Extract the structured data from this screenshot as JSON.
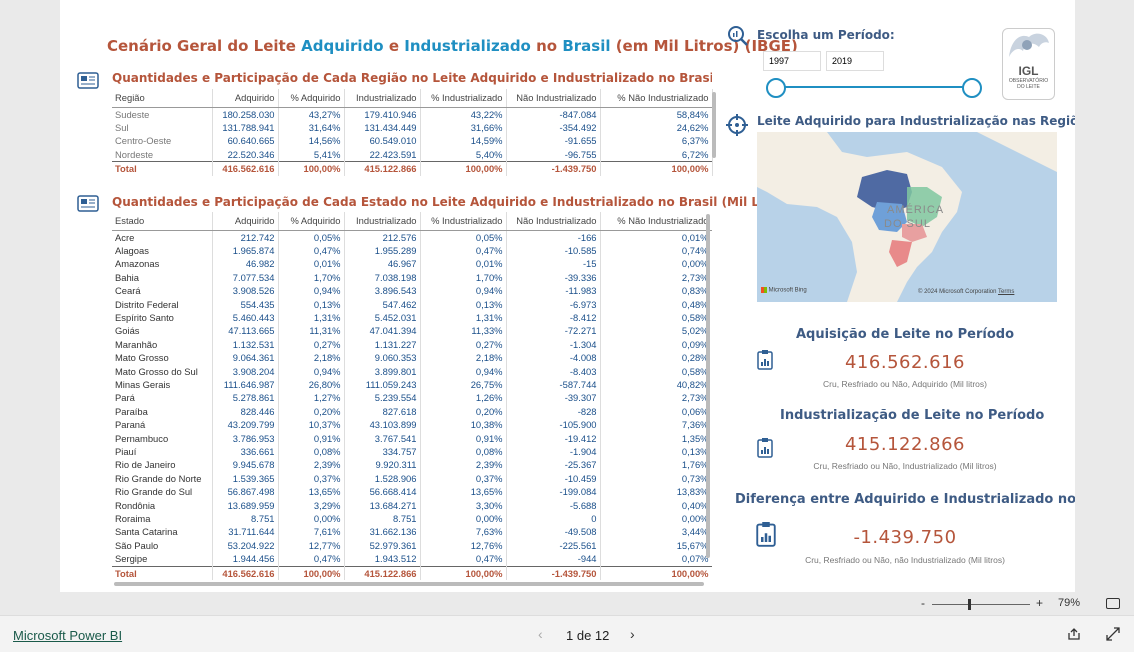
{
  "title": {
    "p1": "Cenário Geral do Leite ",
    "p2": "Adquirido",
    "p3": " e ",
    "p4": "Industrializado",
    "p5": " no ",
    "p6": "Brasil",
    "p7": " (em Mil Litros) (IBGE)"
  },
  "region_table": {
    "title": "Quantidades e Participação de Cada Região no Leite Adquirido e Industrializado no Brasil (Mil Litros",
    "headers": [
      "Região",
      "Adquirido",
      "% Adquirido",
      "Industrializado",
      "% Industrializado",
      "Não Industrializado",
      "% Não Industrializado"
    ],
    "rows": [
      [
        "Sudeste",
        "180.258.030",
        "43,27%",
        "179.410.946",
        "43,22%",
        "-847.084",
        "58,84%"
      ],
      [
        "Sul",
        "131.788.941",
        "31,64%",
        "131.434.449",
        "31,66%",
        "-354.492",
        "24,62%"
      ],
      [
        "Centro-Oeste",
        "60.640.665",
        "14,56%",
        "60.549.010",
        "14,59%",
        "-91.655",
        "6,37%"
      ],
      [
        "Nordeste",
        "22.520.346",
        "5,41%",
        "22.423.591",
        "5,40%",
        "-96.755",
        "6,72%"
      ]
    ],
    "total": [
      "Total",
      "416.562.616",
      "100,00%",
      "415.122.866",
      "100,00%",
      "-1.439.750",
      "100,00%"
    ]
  },
  "state_table": {
    "title": "Quantidades e Participação de Cada Estado no Leite Adquirido e Industrializado no Brasil (Mil Litros)",
    "headers": [
      "Estado",
      "Adquirido",
      "% Adquirido",
      "Industrializado",
      "% Industrializado",
      "Não Industrializado",
      "% Não Industrializado"
    ],
    "rows": [
      [
        "Acre",
        "212.742",
        "0,05%",
        "212.576",
        "0,05%",
        "-166",
        "0,01%"
      ],
      [
        "Alagoas",
        "1.965.874",
        "0,47%",
        "1.955.289",
        "0,47%",
        "-10.585",
        "0,74%"
      ],
      [
        "Amazonas",
        "46.982",
        "0,01%",
        "46.967",
        "0,01%",
        "-15",
        "0,00%"
      ],
      [
        "Bahia",
        "7.077.534",
        "1,70%",
        "7.038.198",
        "1,70%",
        "-39.336",
        "2,73%"
      ],
      [
        "Ceará",
        "3.908.526",
        "0,94%",
        "3.896.543",
        "0,94%",
        "-11.983",
        "0,83%"
      ],
      [
        "Distrito Federal",
        "554.435",
        "0,13%",
        "547.462",
        "0,13%",
        "-6.973",
        "0,48%"
      ],
      [
        "Espírito Santo",
        "5.460.443",
        "1,31%",
        "5.452.031",
        "1,31%",
        "-8.412",
        "0,58%"
      ],
      [
        "Goiás",
        "47.113.665",
        "11,31%",
        "47.041.394",
        "11,33%",
        "-72.271",
        "5,02%"
      ],
      [
        "Maranhão",
        "1.132.531",
        "0,27%",
        "1.131.227",
        "0,27%",
        "-1.304",
        "0,09%"
      ],
      [
        "Mato Grosso",
        "9.064.361",
        "2,18%",
        "9.060.353",
        "2,18%",
        "-4.008",
        "0,28%"
      ],
      [
        "Mato Grosso do Sul",
        "3.908.204",
        "0,94%",
        "3.899.801",
        "0,94%",
        "-8.403",
        "0,58%"
      ],
      [
        "Minas Gerais",
        "111.646.987",
        "26,80%",
        "111.059.243",
        "26,75%",
        "-587.744",
        "40,82%"
      ],
      [
        "Pará",
        "5.278.861",
        "1,27%",
        "5.239.554",
        "1,26%",
        "-39.307",
        "2,73%"
      ],
      [
        "Paraíba",
        "828.446",
        "0,20%",
        "827.618",
        "0,20%",
        "-828",
        "0,06%"
      ],
      [
        "Paraná",
        "43.209.799",
        "10,37%",
        "43.103.899",
        "10,38%",
        "-105.900",
        "7,36%"
      ],
      [
        "Pernambuco",
        "3.786.953",
        "0,91%",
        "3.767.541",
        "0,91%",
        "-19.412",
        "1,35%"
      ],
      [
        "Piauí",
        "336.661",
        "0,08%",
        "334.757",
        "0,08%",
        "-1.904",
        "0,13%"
      ],
      [
        "Rio de Janeiro",
        "9.945.678",
        "2,39%",
        "9.920.311",
        "2,39%",
        "-25.367",
        "1,76%"
      ],
      [
        "Rio Grande do Norte",
        "1.539.365",
        "0,37%",
        "1.528.906",
        "0,37%",
        "-10.459",
        "0,73%"
      ],
      [
        "Rio Grande do Sul",
        "56.867.498",
        "13,65%",
        "56.668.414",
        "13,65%",
        "-199.084",
        "13,83%"
      ],
      [
        "Rondônia",
        "13.689.959",
        "3,29%",
        "13.684.271",
        "3,30%",
        "-5.688",
        "0,40%"
      ],
      [
        "Roraima",
        "8.751",
        "0,00%",
        "8.751",
        "0,00%",
        "0",
        "0,00%"
      ],
      [
        "Santa Catarina",
        "31.711.644",
        "7,61%",
        "31.662.136",
        "7,63%",
        "-49.508",
        "3,44%"
      ],
      [
        "São Paulo",
        "53.204.922",
        "12,77%",
        "52.979.361",
        "12,76%",
        "-225.561",
        "15,67%"
      ],
      [
        "Sergipe",
        "1.944.456",
        "0,47%",
        "1.943.512",
        "0,47%",
        "-944",
        "0,07%"
      ]
    ],
    "total": [
      "Total",
      "416.562.616",
      "100,00%",
      "415.122.866",
      "100,00%",
      "-1.439.750",
      "100,00%"
    ]
  },
  "period": {
    "label": "Escolha um Período:",
    "from": "1997",
    "to": "2019",
    "slider_start_fraction": 0.0,
    "slider_end_fraction": 1.0
  },
  "logo": {
    "line1": "IGL",
    "line2": "OBSERVATÓRIO",
    "line3": "DO LEITE"
  },
  "map": {
    "title": "Leite Adquirido para Industrialização nas Regiões",
    "label1": "AMÉRICA",
    "label2": "DO SUL",
    "bing": "Microsoft Bing",
    "copyright": "© 2024 Microsoft Corporation",
    "terms": "Terms"
  },
  "kpi1": {
    "title": "Aquisição de Leite no Período",
    "value": "416.562.616",
    "sub": "Cru, Resfriado ou Não, Adquirido (Mil litros)"
  },
  "kpi2": {
    "title": "Industrialização de Leite no Período",
    "value": "415.122.866",
    "sub": "Cru, Resfriado ou Não, Industrializado (Mil litros)"
  },
  "kpi3": {
    "title": "Diferença entre Adquirido e Industrializado no Período",
    "value": "-1.439.750",
    "sub": "Cru, Resfriado ou Não, não Industrializado (Mil litros)"
  },
  "zoom": {
    "minus": "-",
    "plus": "+",
    "value": "79%",
    "level_fraction": 0.45
  },
  "footer": {
    "brand": "Microsoft Power BI",
    "page": "1 de 12"
  },
  "colors": {
    "accent_red": "#b5553b",
    "accent_blue": "#1f8fc2",
    "region_sudeste": "#4f6aa3",
    "region_centro": "#6fa0d8",
    "region_nordeste": "#7fc7a0",
    "region_sul": "#e88a8a"
  }
}
